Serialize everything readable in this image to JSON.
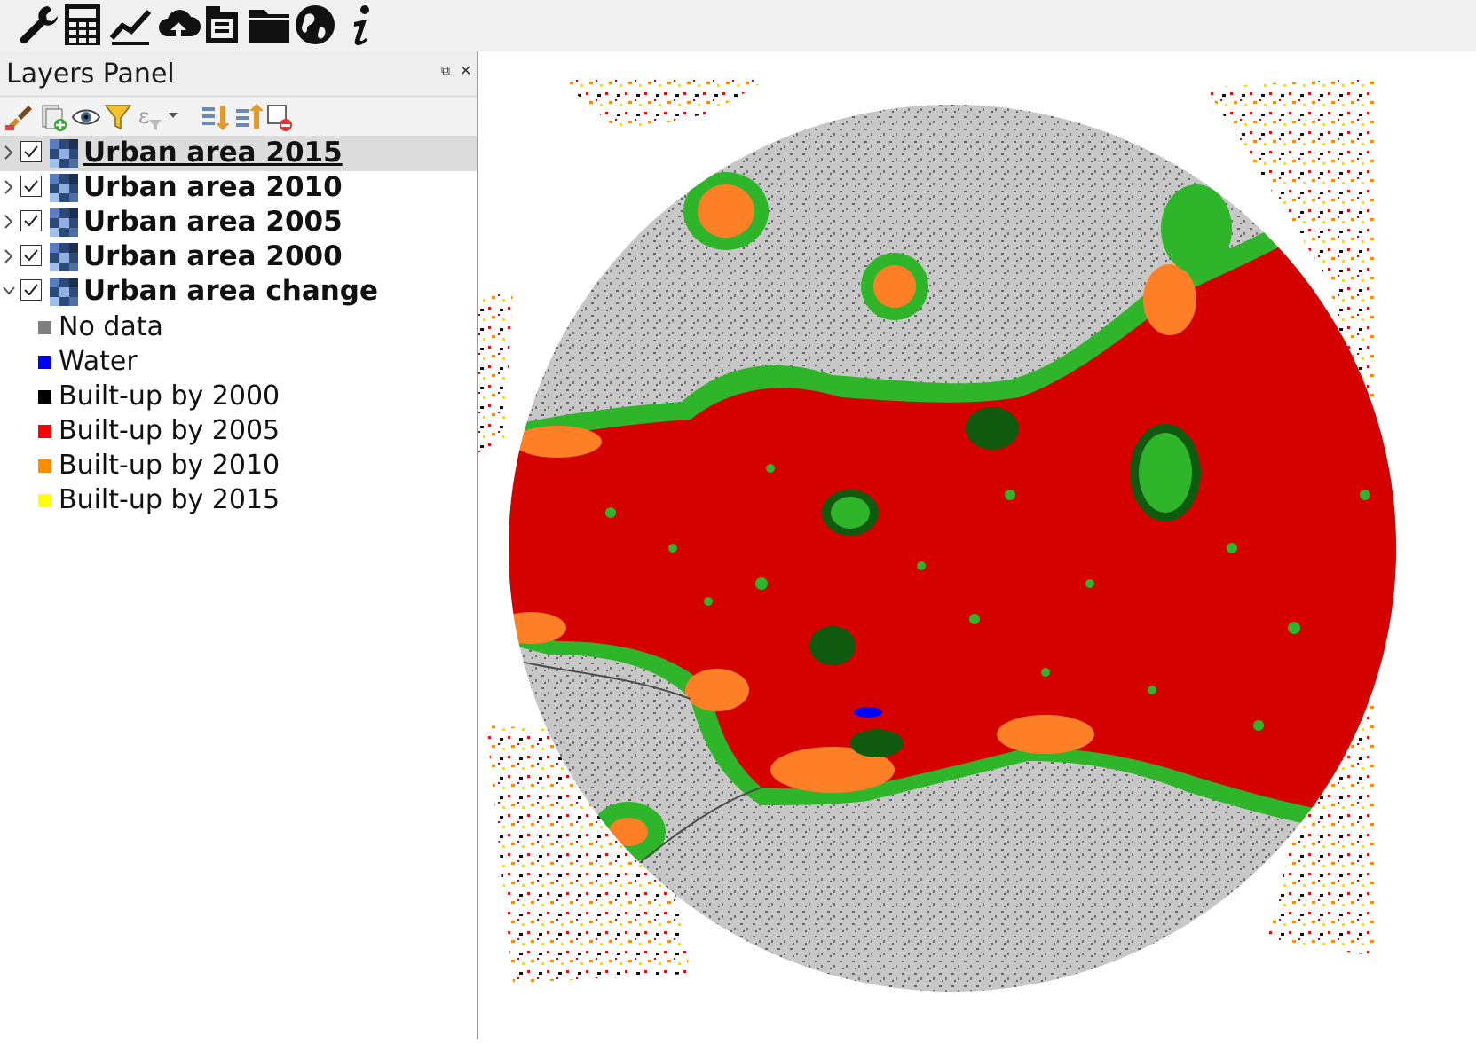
{
  "toolbar": {
    "icons": [
      "wrench-icon",
      "calculator-icon",
      "line-chart-icon",
      "cloud-upload-icon",
      "document-icon",
      "folder-icon",
      "globe-icon",
      "info-icon"
    ]
  },
  "layers_panel": {
    "title": "Layers Panel",
    "toolbar_icons": [
      "style-paint-icon",
      "add-group-icon",
      "eye-icon",
      "filter-icon",
      "expression-filter-icon",
      "expand-all-icon",
      "collapse-all-icon",
      "remove-layer-icon"
    ],
    "layers": [
      {
        "name": "Urban area 2015",
        "checked": true,
        "expanded": false,
        "selected": true
      },
      {
        "name": "Urban area 2010",
        "checked": true,
        "expanded": false,
        "selected": false
      },
      {
        "name": "Urban area 2005",
        "checked": true,
        "expanded": false,
        "selected": false
      },
      {
        "name": "Urban area 2000",
        "checked": true,
        "expanded": false,
        "selected": false
      },
      {
        "name": "Urban area change",
        "checked": true,
        "expanded": true,
        "selected": false
      }
    ],
    "legend": [
      {
        "label": "No data",
        "color": "#7f7f7f"
      },
      {
        "label": "Water",
        "color": "#0000ff"
      },
      {
        "label": "Built-up by 2000",
        "color": "#000000"
      },
      {
        "label": "Built-up by 2005",
        "color": "#ff0000"
      },
      {
        "label": "Built-up by 2010",
        "color": "#ff8c00"
      },
      {
        "label": "Built-up by 2015",
        "color": "#ffff00"
      }
    ]
  },
  "map": {
    "colors": {
      "circle_gray": "#c7c7c7",
      "urban_red": "#d50000",
      "edge_green": "#2fb52a",
      "forest_dark": "#0f5a0f",
      "fringe_orange": "#ff7f27",
      "speckle_dark": "#4a4a4a",
      "water_blue": "#0000ff"
    }
  }
}
